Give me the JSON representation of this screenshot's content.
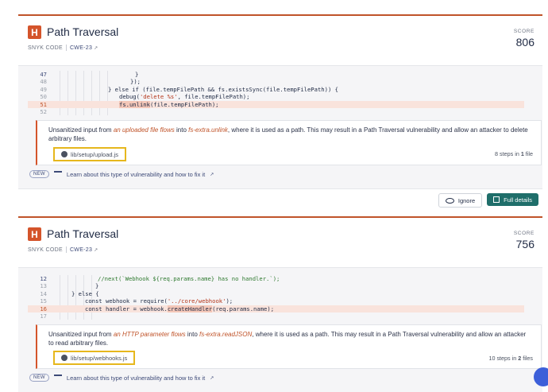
{
  "issues": [
    {
      "badge": "H",
      "title": "Path Traversal",
      "source_label": "SNYK CODE",
      "cwe_label": "CWE-23",
      "score_label": "SCORE",
      "score": "806",
      "code_lines": [
        {
          "num": "47",
          "text": "}"
        },
        {
          "num": "48",
          "text": "});"
        },
        {
          "num": "49",
          "text": "} else if (file.tempFilePath && fs.existsSync(file.tempFilePath)) {"
        },
        {
          "num": "50",
          "text_pre": "debug(",
          "text_str": "'delete %s'",
          "text_post": ", file.tempFilePath);"
        },
        {
          "num": "51",
          "text_mark": "fs.unlink",
          "text_post": "(file.tempFilePath);"
        },
        {
          "num": "52",
          "text": ""
        }
      ],
      "message": {
        "pre": "Unsanitized input from ",
        "source": "an uploaded file flows",
        "mid": " into ",
        "sink": "fs-extra.unlink",
        "post": ", where it is used as a path. This may result in a Path Traversal vulnerability and allow an attacker to delete arbitrary files."
      },
      "file": "lib/setup/upload.js",
      "steps_pre": "8 steps in ",
      "steps_num": "1",
      "steps_post": " file",
      "new_label": "NEW",
      "learn_label": "Learn about this type of vulnerability and how to fix it"
    },
    {
      "badge": "H",
      "title": "Path Traversal",
      "source_label": "SNYK CODE",
      "cwe_label": "CWE-23",
      "score_label": "SCORE",
      "score": "756",
      "code_lines": [
        {
          "num": "12",
          "text": "//next(`Webhook ${req.params.name} has no handler.`);"
        },
        {
          "num": "13",
          "text": "}"
        },
        {
          "num": "14",
          "text": "} else {"
        },
        {
          "num": "15",
          "text_pre": "const webhook = require(",
          "text_str": "'../core/webhook'",
          "text_post": ");"
        },
        {
          "num": "16",
          "text_pre": "const handler = webhook.",
          "text_mark": "createHandler",
          "text_post": "(req.params.name);"
        },
        {
          "num": "17",
          "text": ""
        }
      ],
      "message": {
        "pre": "Unsanitized input from ",
        "source": "an HTTP parameter flows",
        "mid": " into ",
        "sink": "fs-extra.readJSON",
        "post": ", where it is used as a path. This may result in a Path Traversal vulnerability and allow an attacker to read arbitrary files."
      },
      "file": "lib/setup/webhooks.js",
      "steps_pre": "10 steps in ",
      "steps_num": "2",
      "steps_post": " files",
      "new_label": "NEW",
      "learn_label": "Learn about this type of vulnerability and how to fix it"
    }
  ],
  "actions": {
    "ignore_label": "Ignore",
    "full_details_label": "Full details"
  }
}
